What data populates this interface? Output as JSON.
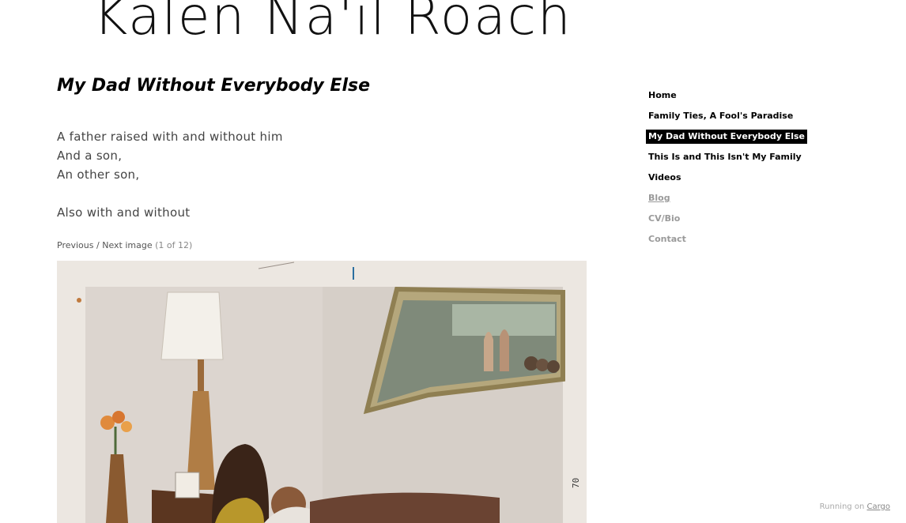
{
  "site": {
    "title": "Kalen Na'il Roach"
  },
  "page": {
    "title": "My Dad Without Everybody Else",
    "poem": {
      "stanza1": [
        "A father raised with and without him",
        "And a son,",
        "An other son,"
      ],
      "stanza2": [
        "Also with and without"
      ]
    }
  },
  "gallery": {
    "previous_label": "Previous",
    "separator": "/",
    "next_label": "Next image",
    "counter": "(1 of 12)"
  },
  "nav": {
    "items": [
      {
        "label": "Home",
        "state": "default"
      },
      {
        "label": "Family Ties, A Fool's Paradise",
        "state": "default"
      },
      {
        "label": "My Dad Without Everybody Else",
        "state": "active"
      },
      {
        "label": "This Is and This Isn't My Family",
        "state": "default"
      },
      {
        "label": "Videos",
        "state": "default"
      },
      {
        "label": "Blog",
        "state": "muted-underlined"
      },
      {
        "label": "CV/Bio",
        "state": "muted"
      },
      {
        "label": "Contact",
        "state": "muted"
      }
    ]
  },
  "footer": {
    "prefix": "Running on",
    "link_label": "Cargo"
  },
  "photo": {
    "edge_mark": "70"
  }
}
